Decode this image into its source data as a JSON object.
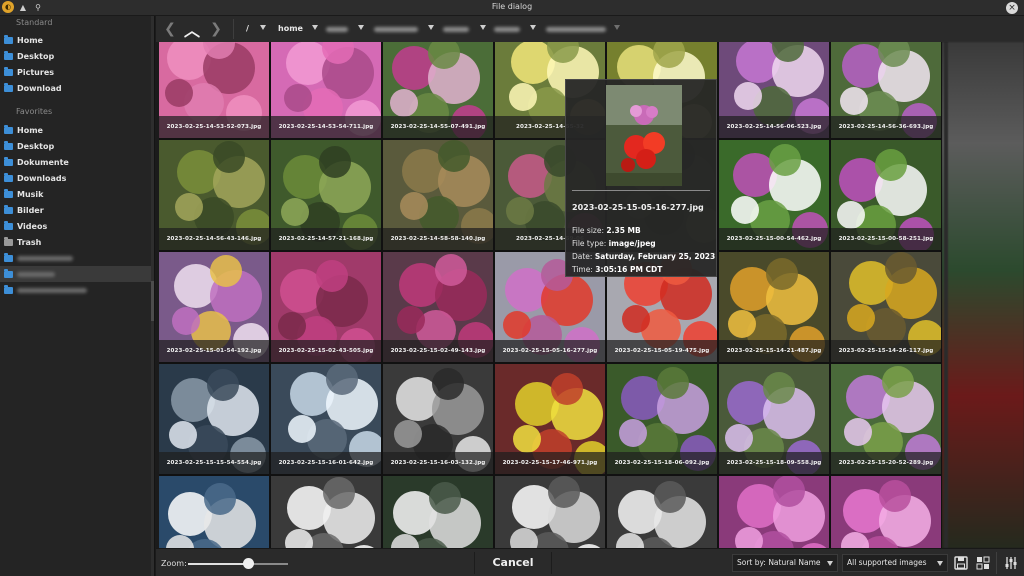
{
  "window": {
    "title": "File dialog",
    "close_icon": "close-icon"
  },
  "sidebar": {
    "standard_title": "Standard",
    "standard_items": [
      {
        "label": "Home",
        "icon": "folder-icon"
      },
      {
        "label": "Desktop",
        "icon": "folder-icon"
      },
      {
        "label": "Pictures",
        "icon": "folder-icon"
      },
      {
        "label": "Download",
        "icon": "folder-icon"
      }
    ],
    "favorites_title": "Favorites",
    "favorite_items": [
      {
        "label": "Home",
        "icon": "folder-icon"
      },
      {
        "label": "Desktop",
        "icon": "folder-icon"
      },
      {
        "label": "Dokumente",
        "icon": "folder-icon"
      },
      {
        "label": "Downloads",
        "icon": "folder-icon"
      },
      {
        "label": "Musik",
        "icon": "folder-icon"
      },
      {
        "label": "Bilder",
        "icon": "folder-icon"
      },
      {
        "label": "Videos",
        "icon": "folder-icon"
      },
      {
        "label": "Trash",
        "icon": "trash-icon"
      }
    ]
  },
  "pathbar": {
    "root": "/",
    "home": "home"
  },
  "files": [
    "2023-02-25-14-53-52-073.jpg",
    "2023-02-25-14-53-54-711.jpg",
    "2023-02-25-14-55-07-491.jpg",
    "2023-02-25-14-55-32",
    "",
    "2023-02-25-14-56-06-523.jpg",
    "2023-02-25-14-56-36-693.jpg",
    "2023-02-25-14-56-43-146.jpg",
    "2023-02-25-14-57-21-168.jpg",
    "2023-02-25-14-58-58-140.jpg",
    "2023-02-25-14-59-06",
    "",
    "2023-02-25-15-00-54-462.jpg",
    "2023-02-25-15-00-58-251.jpg",
    "2023-02-25-15-01-54-192.jpg",
    "2023-02-25-15-02-43-505.jpg",
    "2023-02-25-15-02-49-143.jpg",
    "2023-02-25-15-05-16-277.jpg",
    "2023-02-25-15-05-19-475.jpg",
    "2023-02-25-15-14-21-487.jpg",
    "2023-02-25-15-14-26-117.jpg",
    "2023-02-25-15-15-54-554.jpg",
    "2023-02-25-15-16-01-642.jpg",
    "2023-02-25-15-16-03-132.jpg",
    "2023-02-25-15-17-46-971.jpg",
    "2023-02-25-15-18-06-092.jpg",
    "2023-02-25-15-18-09-558.jpg",
    "2023-02-25-15-20-52-289.jpg",
    "",
    "",
    "",
    "",
    "",
    "",
    ""
  ],
  "tooltip": {
    "filename": "2023-02-25-15-05-16-277.jpg",
    "size_label": "File size:",
    "size_value": "2.35 MB",
    "type_label": "File type:",
    "type_value": "image/jpeg",
    "date_label": "Date:",
    "date_value": "Saturday, February 25, 2023",
    "time_label": "Time:",
    "time_value": "3:05:16 PM CDT"
  },
  "bottombar": {
    "zoom_label": "Zoom:",
    "zoom_level": 0.6,
    "cancel_label": "Cancel",
    "sort_label": "Sort by: Natural Name",
    "filter_label": "All supported images"
  },
  "colors": {
    "accent": "#3d8fd8",
    "panel": "#2a2a2a",
    "sidebar": "#242424"
  }
}
